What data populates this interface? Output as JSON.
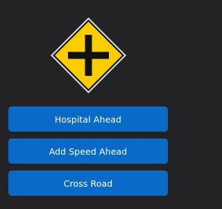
{
  "sign": {
    "icon": "crossroad-warning-sign-icon",
    "colors": {
      "fill": "#f9cc00",
      "border": "#ffffff",
      "symbol": "#111111"
    }
  },
  "answers": [
    {
      "label": "Hospital Ahead"
    },
    {
      "label": "Add Speed Ahead"
    },
    {
      "label": "Cross Road"
    }
  ],
  "colors": {
    "background": "#232325",
    "button": "#0a6ac8",
    "button_text": "#ffffff"
  }
}
